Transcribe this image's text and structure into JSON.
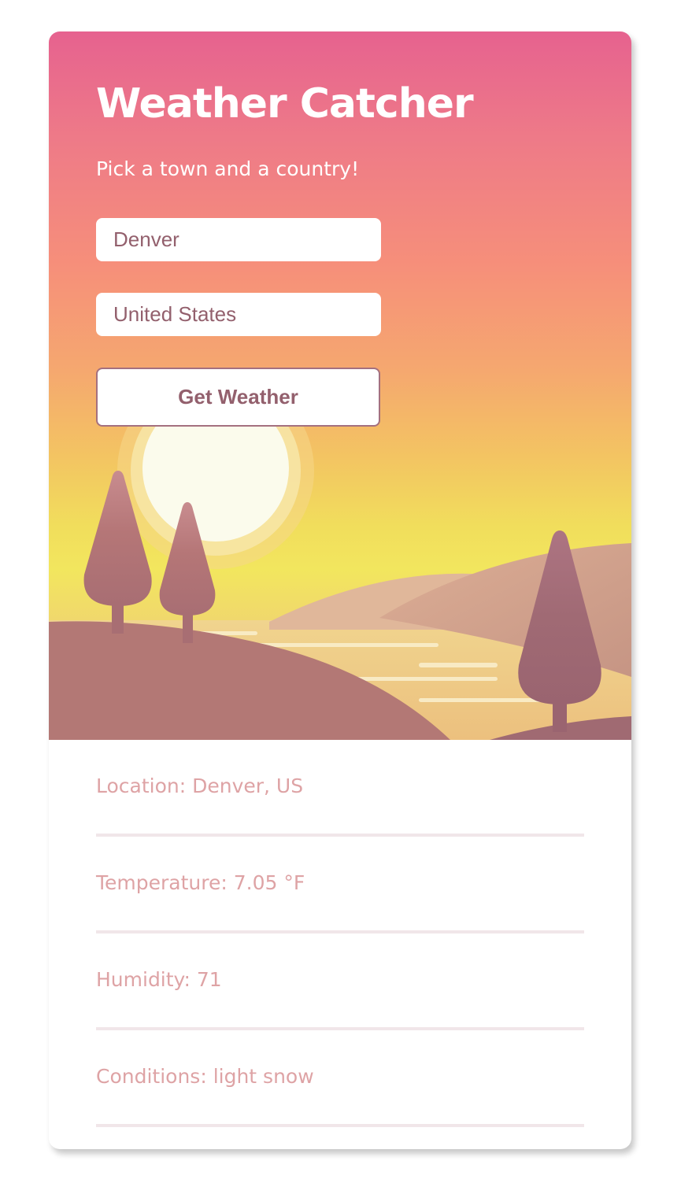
{
  "app": {
    "title": "Weather Catcher",
    "subtitle": "Pick a town and a country!"
  },
  "form": {
    "city_value": "Denver",
    "country_value": "United States",
    "submit_label": "Get Weather"
  },
  "results": {
    "location": "Location: Denver, US",
    "temperature": "Temperature: 7.05 °F",
    "humidity": "Humidity: 71",
    "conditions": "Conditions: light snow"
  },
  "colors": {
    "gradient_top": "#e6628f",
    "gradient_mid": "#f68f7a",
    "gradient_bottom": "#f2e65e",
    "accent_text": "#93606d",
    "result_text": "#dea3a5",
    "divider": "#f1e6e9"
  },
  "icons": {
    "illustration": "sunset-landscape-illustration"
  }
}
